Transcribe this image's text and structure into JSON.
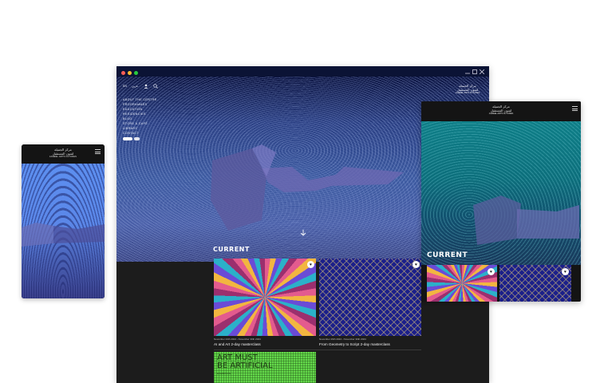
{
  "brand": {
    "arabic_line1": "مركز الجميلة",
    "arabic_line2": "لفنون المستقبل",
    "name": "JAMEEL ARTS FUTURES"
  },
  "topbar": {
    "lang_en": "EN",
    "lang_ar": "عربي"
  },
  "nav": {
    "items": [
      "ABOUT THE CENTRE",
      "PROGRAMMES",
      "EDUCATION",
      "RESIDENCIES",
      "BLOG",
      "STORE & CAFÉ",
      "LIBRARY",
      "CONTACT"
    ]
  },
  "hero": {
    "section_title": "CURRENT"
  },
  "cards": [
    {
      "date": "November 24th 2024 - November 30th 2024",
      "title": "AI and Art 2-day masterclass"
    },
    {
      "date": "November 29th 2024 - November 30th 2024",
      "title": "From Geometry to Script 2-day masterclass"
    },
    {
      "poster_line1": "ART MUST",
      "poster_line2": "BE ARTIFICIAL",
      "poster_sub": "EXHIBITION"
    }
  ],
  "tablet": {
    "section_title": "CURRENT"
  },
  "colors": {
    "window_bar": "#0b1335",
    "page_bg": "#1c1c1c",
    "teal": "#0f7f88",
    "poster_green": "#63d84a"
  },
  "icons": [
    "search-icon",
    "user-icon",
    "heart-icon",
    "arrow-down-icon",
    "hamburger-icon",
    "close-icon",
    "minimize-icon",
    "maximize-icon"
  ]
}
